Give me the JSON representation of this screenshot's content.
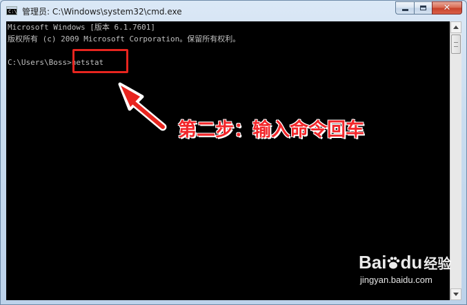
{
  "window": {
    "title": "管理员: C:\\Windows\\system32\\cmd.exe",
    "icon": "cmd-icon",
    "icon_text": "C:\\",
    "controls": {
      "minimize": "minimize-icon",
      "maximize": "maximize-icon",
      "close": "close-icon",
      "close_glyph": "✕"
    }
  },
  "console": {
    "lines": [
      "Microsoft Windows [版本 6.1.7601]",
      "版权所有 (c) 2009 Microsoft Corporation。保留所有权利。",
      "",
      "C:\\Users\\Boss>netstat"
    ],
    "text_color": "#c0c0c0",
    "background": "#000000"
  },
  "annotation": {
    "text": "第二步：输入命令回车",
    "color": "#f2262a"
  },
  "watermark": {
    "logo_bai": "Bai",
    "logo_du": "du",
    "logo_jingyan": "经验",
    "url": "jingyan.baidu.com"
  }
}
